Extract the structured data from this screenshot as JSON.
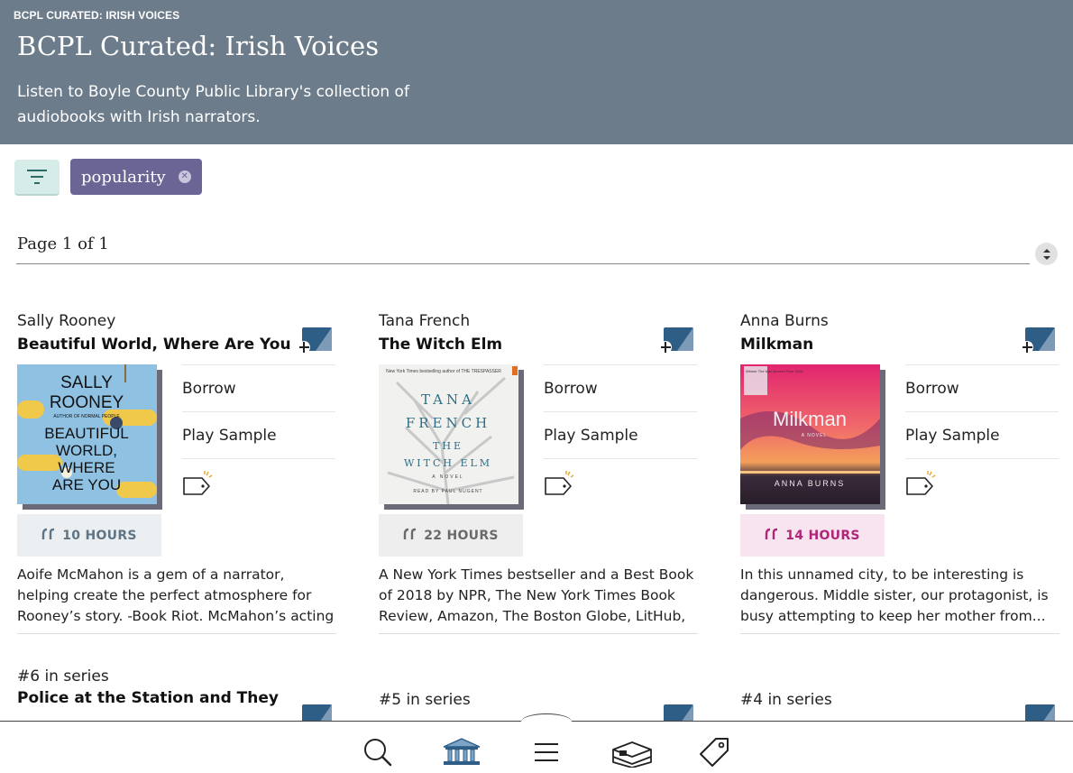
{
  "header": {
    "breadcrumb": "BCPL CURATED: IRISH VOICES",
    "title": "BCPL Curated: Irish Voices",
    "description": "Listen to Boyle County Public Library's collection of audiobooks with Irish narrators."
  },
  "filters": {
    "chip_label": "popularity"
  },
  "paging": {
    "page_label": "Page 1 of 1"
  },
  "books": [
    {
      "author": "Sally Rooney",
      "title": "Beautiful World, Where Are You",
      "borrow": "Borrow",
      "sample": "Play Sample",
      "hours": "10 HOURS",
      "blurb": "Aoife McMahon is a gem of a narrator, helping create the perfect atmosphere for Rooney’s story. -Book Riot. McMahon’s acting dexterity...",
      "cover_lines": [
        "SALLY",
        "ROONEY",
        "BEAUTIFUL",
        "WORLD,",
        "WHERE",
        "ARE YOU"
      ],
      "cover_small": "AUTHOR OF NORMAL PEOPLE"
    },
    {
      "author": "Tana French",
      "title": "The Witch Elm",
      "borrow": "Borrow",
      "sample": "Play Sample",
      "hours": "22 HOURS",
      "blurb": "A New York Times bestseller and a Best Book of 2018 by NPR, The New York Times Book Review, Amazon, The Boston Globe, LitHub, Vulture,...",
      "cover_top": "New York Times bestselling author of THE TRESPASSER",
      "cover_lines": [
        "TANA",
        "FRENCH",
        "THE",
        "WITCH ELM"
      ],
      "cover_small": "A NOVEL",
      "cover_reader": "READ BY PAUL NUGENT"
    },
    {
      "author": "Anna Burns",
      "title": "Milkman",
      "borrow": "Borrow",
      "sample": "Play Sample",
      "hours": "14 HOURS",
      "blurb": "In this unnamed city, to be interesting is dangerous. Middle sister, our protagonist, is busy attempting to keep her mother from...",
      "cover_top": "Winner The Man Booker Prize 2018",
      "cover_lines": [
        "Milkman"
      ],
      "cover_small": "A NOVEL",
      "cover_author": "ANNA BURNS"
    }
  ],
  "next_row": [
    {
      "series": "#6 in series",
      "title": "Police at the Station and They"
    },
    {
      "series": "#5 in series",
      "title": ""
    },
    {
      "series": "#4 in series",
      "title": ""
    }
  ],
  "colors": {
    "header_bg": "#6d7c8b",
    "chip_bg": "#6a6595",
    "filter_bg": "#d6ece8",
    "hours_default_bg": "#eceff1",
    "hours_default_fg": "#5f7585",
    "hours_gray_fg": "#6a6a6a",
    "hours_pink_bg": "#f8e4ef",
    "hours_pink_fg": "#b0247a"
  },
  "nav": {
    "icons": [
      "search-icon",
      "library-icon",
      "menu-icon",
      "shelf-icon",
      "tags-icon"
    ]
  }
}
